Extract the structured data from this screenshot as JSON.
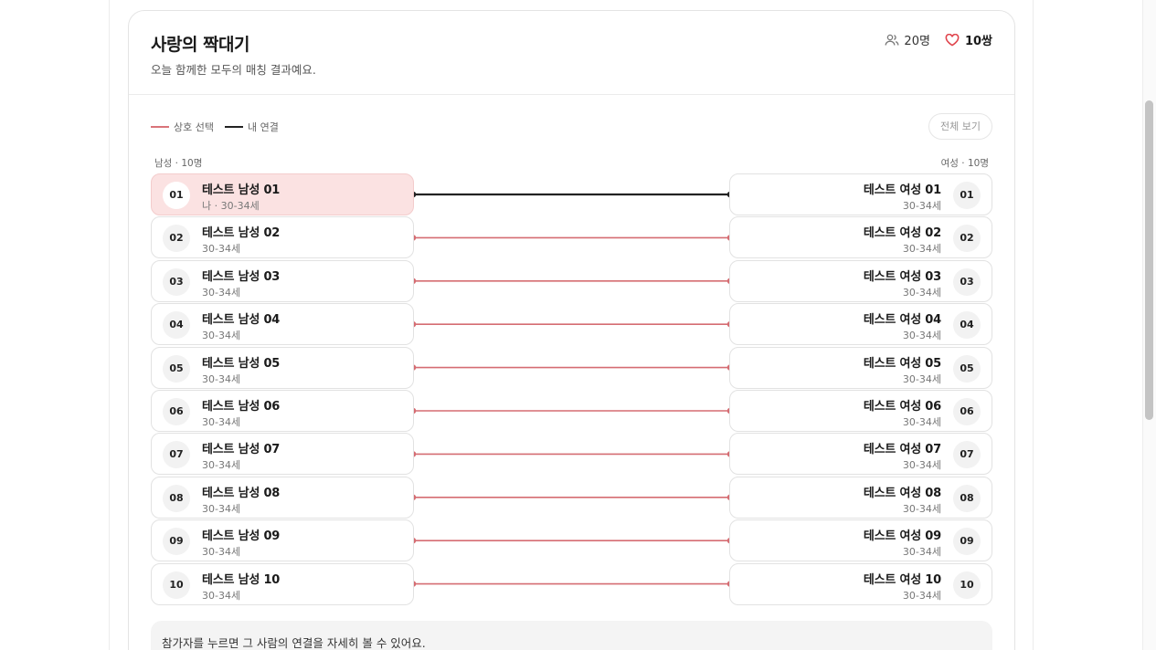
{
  "header": {
    "title": "사랑의 짝대기",
    "subtitle": "오늘 함께한 모두의 매칭 결과예요.",
    "people_count": "20명",
    "pairs_count": "10쌍"
  },
  "legend": {
    "mutual_label": "상호 선택",
    "mine_label": "내 연결"
  },
  "view_all_label": "전체 보기",
  "columns": {
    "male_label": "남성 · 10명",
    "female_label": "여성 · 10명"
  },
  "men": [
    {
      "num": "01",
      "name": "테스트 남성 01",
      "age": "나 · 30-34세",
      "me": true
    },
    {
      "num": "02",
      "name": "테스트 남성 02",
      "age": "30-34세"
    },
    {
      "num": "03",
      "name": "테스트 남성 03",
      "age": "30-34세"
    },
    {
      "num": "04",
      "name": "테스트 남성 04",
      "age": "30-34세"
    },
    {
      "num": "05",
      "name": "테스트 남성 05",
      "age": "30-34세"
    },
    {
      "num": "06",
      "name": "테스트 남성 06",
      "age": "30-34세"
    },
    {
      "num": "07",
      "name": "테스트 남성 07",
      "age": "30-34세"
    },
    {
      "num": "08",
      "name": "테스트 남성 08",
      "age": "30-34세"
    },
    {
      "num": "09",
      "name": "테스트 남성 09",
      "age": "30-34세"
    },
    {
      "num": "10",
      "name": "테스트 남성 10",
      "age": "30-34세"
    }
  ],
  "women": [
    {
      "num": "01",
      "name": "테스트 여성 01",
      "age": "30-34세"
    },
    {
      "num": "02",
      "name": "테스트 여성 02",
      "age": "30-34세"
    },
    {
      "num": "03",
      "name": "테스트 여성 03",
      "age": "30-34세"
    },
    {
      "num": "04",
      "name": "테스트 여성 04",
      "age": "30-34세"
    },
    {
      "num": "05",
      "name": "테스트 여성 05",
      "age": "30-34세"
    },
    {
      "num": "06",
      "name": "테스트 여성 06",
      "age": "30-34세"
    },
    {
      "num": "07",
      "name": "테스트 여성 07",
      "age": "30-34세"
    },
    {
      "num": "08",
      "name": "테스트 여성 08",
      "age": "30-34세"
    },
    {
      "num": "09",
      "name": "테스트 여성 09",
      "age": "30-34세"
    },
    {
      "num": "10",
      "name": "테스트 여성 10",
      "age": "30-34세"
    }
  ],
  "links": [
    {
      "from": 0,
      "to": 0,
      "kind": "mine"
    },
    {
      "from": 1,
      "to": 1,
      "kind": "mutual"
    },
    {
      "from": 2,
      "to": 2,
      "kind": "mutual"
    },
    {
      "from": 3,
      "to": 3,
      "kind": "mutual"
    },
    {
      "from": 4,
      "to": 4,
      "kind": "mutual"
    },
    {
      "from": 5,
      "to": 5,
      "kind": "mutual"
    },
    {
      "from": 6,
      "to": 6,
      "kind": "mutual"
    },
    {
      "from": 7,
      "to": 7,
      "kind": "mutual"
    },
    {
      "from": 8,
      "to": 8,
      "kind": "mutual"
    },
    {
      "from": 9,
      "to": 9,
      "kind": "mutual"
    }
  ],
  "colors": {
    "mutual": "#d56c72",
    "mine": "#222222",
    "me_highlight": "#fbe2e2"
  },
  "hint_text": "참가자를 누르면 그 사람의 연결을 자세히 볼 수 있어요."
}
